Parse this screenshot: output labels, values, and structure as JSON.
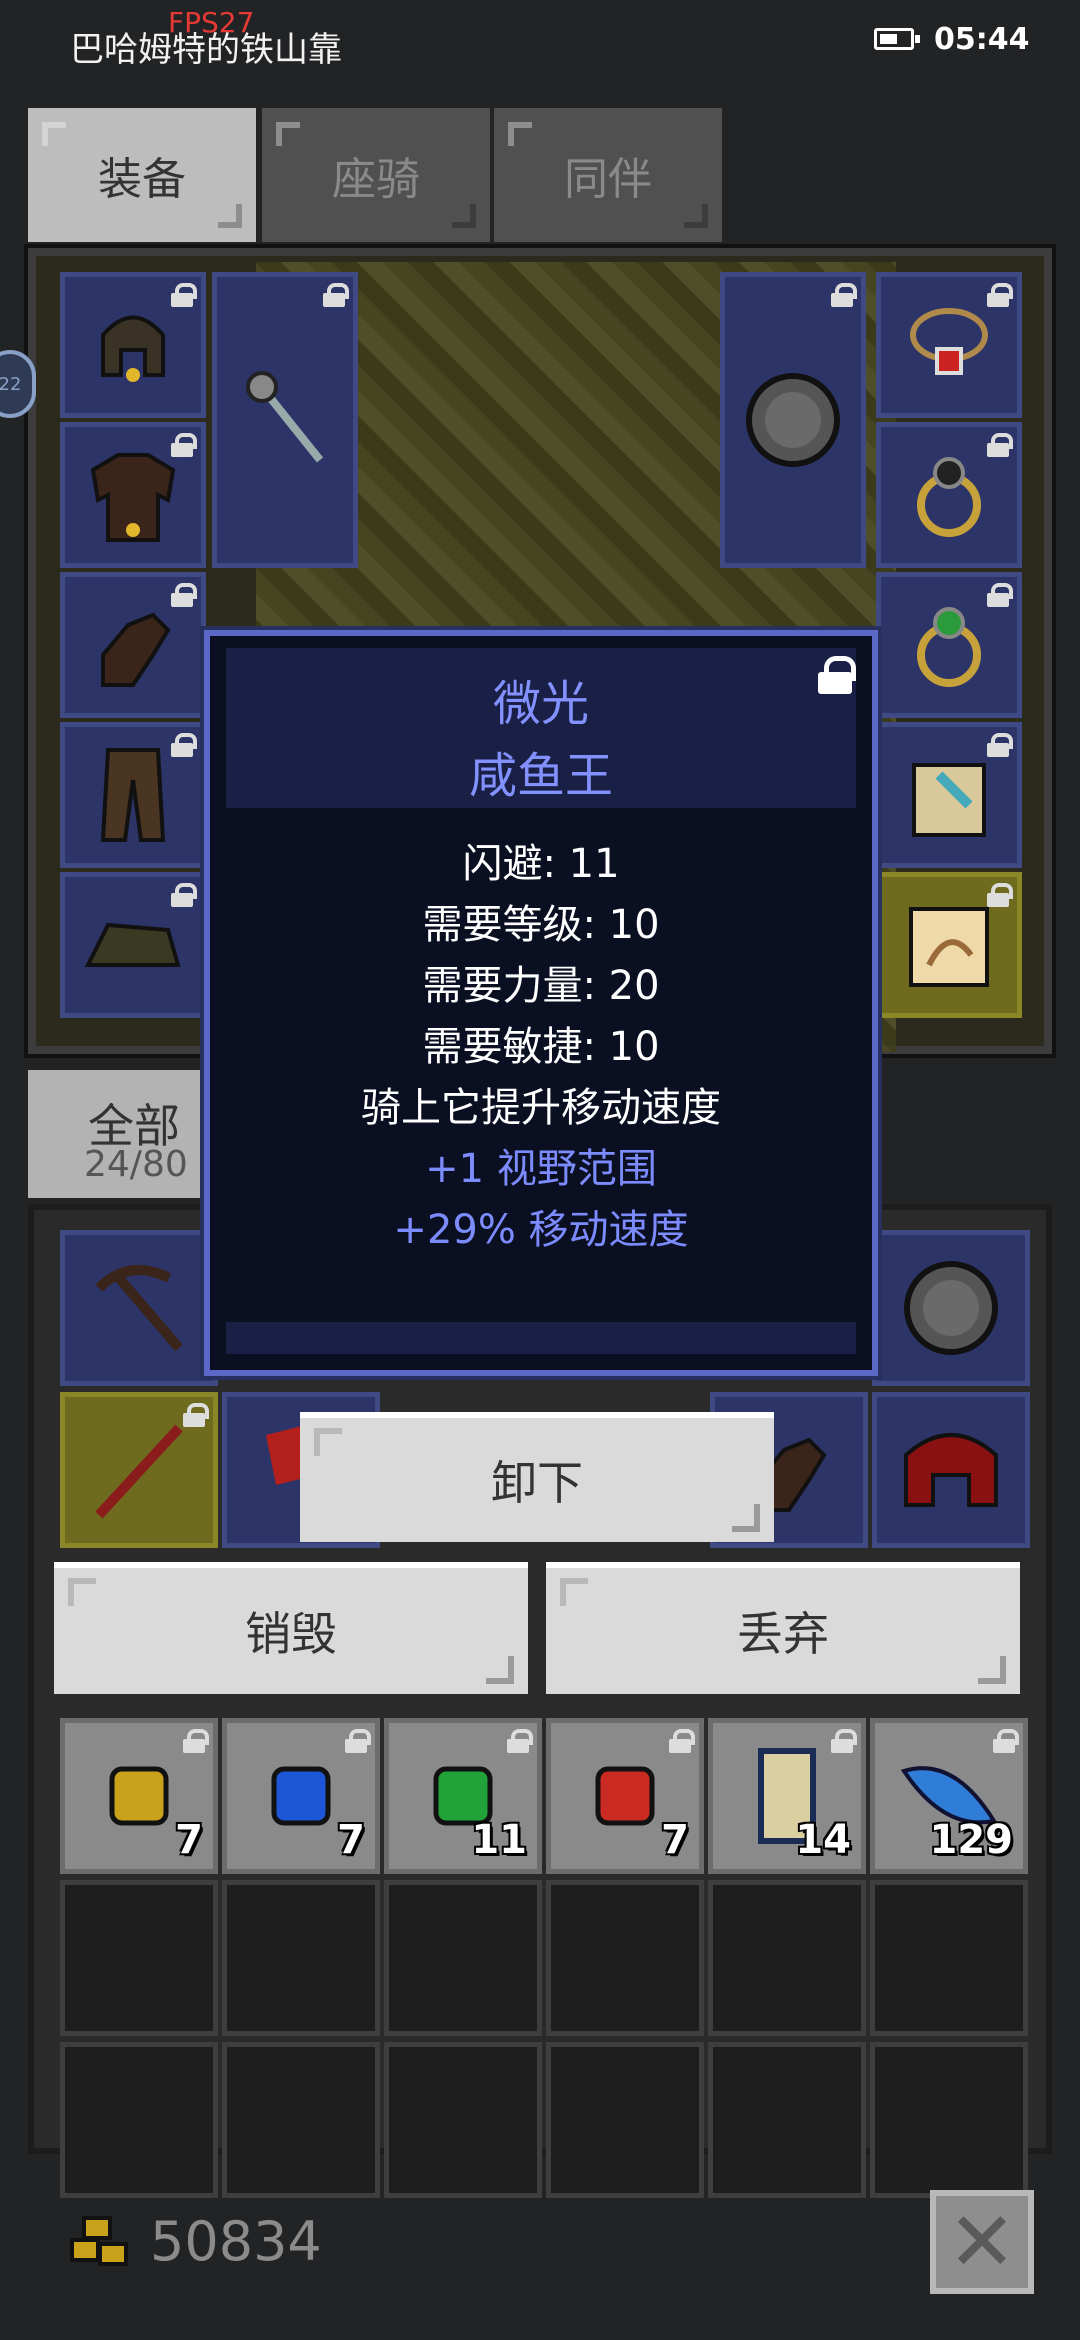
{
  "status_bar": {
    "title": "巴哈姆特的铁山靠",
    "fps": "FPS27",
    "time": "05:44",
    "battery_level": 0.6
  },
  "tabs": [
    {
      "label": "装备",
      "active": true
    },
    {
      "label": "座骑",
      "active": false
    },
    {
      "label": "同伴",
      "active": false
    }
  ],
  "side_badge": "22",
  "category": {
    "name": "全部",
    "count": "24/80"
  },
  "tooltip": {
    "quality": "微光",
    "name": "咸鱼王",
    "stats": [
      {
        "text": "闪避: 11",
        "color": "white"
      },
      {
        "text": "需要等级: 10",
        "color": "white"
      },
      {
        "text": "需要力量: 20",
        "color": "white"
      },
      {
        "text": "需要敏捷: 10",
        "color": "white"
      },
      {
        "text": "骑上它提升移动速度",
        "color": "white"
      },
      {
        "text": "+1 视野范围",
        "color": "blue"
      },
      {
        "text": "+29% 移动速度",
        "color": "blue"
      }
    ]
  },
  "actions": {
    "unequip": "卸下",
    "destroy": "销毁",
    "discard": "丢弃"
  },
  "consumables": [
    {
      "icon": "yellow-gem-icon",
      "qty": "7",
      "color": "#c9a21c"
    },
    {
      "icon": "blue-gem-icon",
      "qty": "7",
      "color": "#1e56d8"
    },
    {
      "icon": "green-gem-icon",
      "qty": "11",
      "color": "#22a33a"
    },
    {
      "icon": "red-gem-icon",
      "qty": "7",
      "color": "#c92a22"
    },
    {
      "icon": "scroll-icon",
      "qty": "14",
      "color": "#d9cfa0"
    },
    {
      "icon": "feather-icon",
      "qty": "129",
      "color": "#2f7dd6"
    }
  ],
  "gold": "50834",
  "colors": {
    "background": "#222325",
    "slot_blue": "#2c3468",
    "tooltip_text_blue": "#7c8cff"
  }
}
